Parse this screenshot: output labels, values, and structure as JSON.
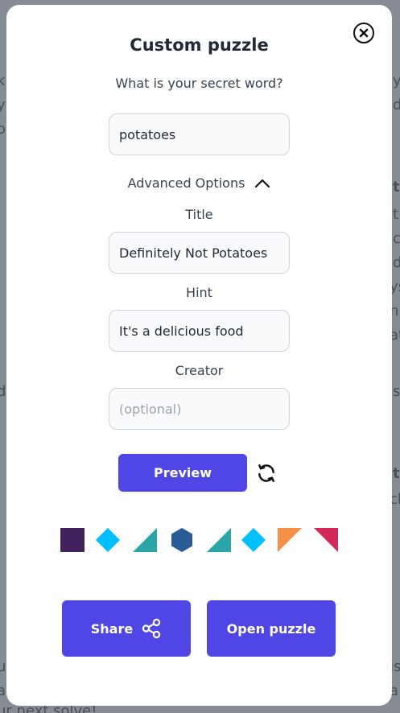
{
  "background": {
    "fragments": [
      {
        "text": "k"
      },
      {
        "text": "y"
      },
      {
        "text": "o"
      },
      {
        "text": "y"
      },
      {
        "text": "d"
      },
      {
        "text": "t"
      },
      {
        "text": "t"
      },
      {
        "text": "c"
      },
      {
        "text": "d"
      },
      {
        "text": "ys"
      },
      {
        "text": "nb"
      },
      {
        "text": "at"
      },
      {
        "text": "d"
      },
      {
        "text": "s"
      },
      {
        "text": "t"
      },
      {
        "text": "ch"
      },
      {
        "text": "u"
      },
      {
        "text": "is"
      },
      {
        "text": "a"
      },
      {
        "text": "a"
      },
      {
        "text": "ur next solve!"
      }
    ]
  },
  "modal": {
    "title": "Custom puzzle",
    "subtitle": "What is your secret word?",
    "secret_word": {
      "value": "potatoes",
      "placeholder": ""
    },
    "advanced_options_label": "Advanced Options",
    "title_field": {
      "label": "Title",
      "value": "Definitely Not Potatoes"
    },
    "hint_field": {
      "label": "Hint",
      "value": "It's a delicious food"
    },
    "creator_field": {
      "label": "Creator",
      "value": "",
      "placeholder": "(optional)"
    },
    "preview_label": "Preview",
    "share_label": "Share",
    "open_puzzle_label": "Open puzzle"
  },
  "shapes": [
    {
      "name": "square",
      "color": "#43215c"
    },
    {
      "name": "diamond",
      "color": "#00bfff"
    },
    {
      "name": "triangle-right",
      "color": "#2ba6a8"
    },
    {
      "name": "hexagon",
      "color": "#2a5c95"
    },
    {
      "name": "triangle-right",
      "color": "#2ba6a8"
    },
    {
      "name": "diamond",
      "color": "#00bfff"
    },
    {
      "name": "triangle-top-left",
      "color": "#f59048"
    },
    {
      "name": "triangle-top-right",
      "color": "#d4285a"
    }
  ],
  "colors": {
    "accent": "#4f46e5"
  }
}
